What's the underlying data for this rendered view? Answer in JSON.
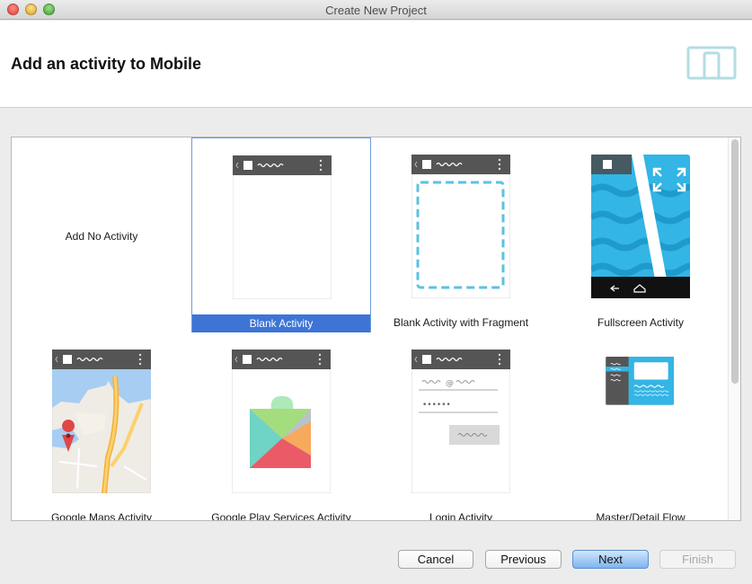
{
  "window": {
    "title": "Create New Project"
  },
  "header": {
    "title": "Add an activity to Mobile",
    "icon": "devices-icon"
  },
  "activities": [
    {
      "label": "Add No Activity",
      "thumbnail": "none",
      "selected": false
    },
    {
      "label": "Blank Activity",
      "thumbnail": "blank-activity-icon",
      "selected": true
    },
    {
      "label": "Blank Activity with Fragment",
      "thumbnail": "fragment-activity-icon",
      "selected": false
    },
    {
      "label": "Fullscreen Activity",
      "thumbnail": "fullscreen-activity-icon",
      "selected": false
    },
    {
      "label": "Google Maps Activity",
      "thumbnail": "map-activity-icon",
      "selected": false
    },
    {
      "label": "Google Play Services Activity",
      "thumbnail": "play-services-icon",
      "selected": false
    },
    {
      "label": "Login Activity",
      "thumbnail": "login-activity-icon",
      "selected": false
    },
    {
      "label": "Master/Detail Flow",
      "thumbnail": "master-detail-icon",
      "selected": false
    }
  ],
  "buttons": {
    "cancel": "Cancel",
    "previous": "Previous",
    "next": "Next",
    "finish": "Finish"
  },
  "colors": {
    "selection": "#3d74d6",
    "action_bar": "#555555",
    "accent_blue": "#33b5e5",
    "fragment_dash": "#5bc2e0"
  }
}
